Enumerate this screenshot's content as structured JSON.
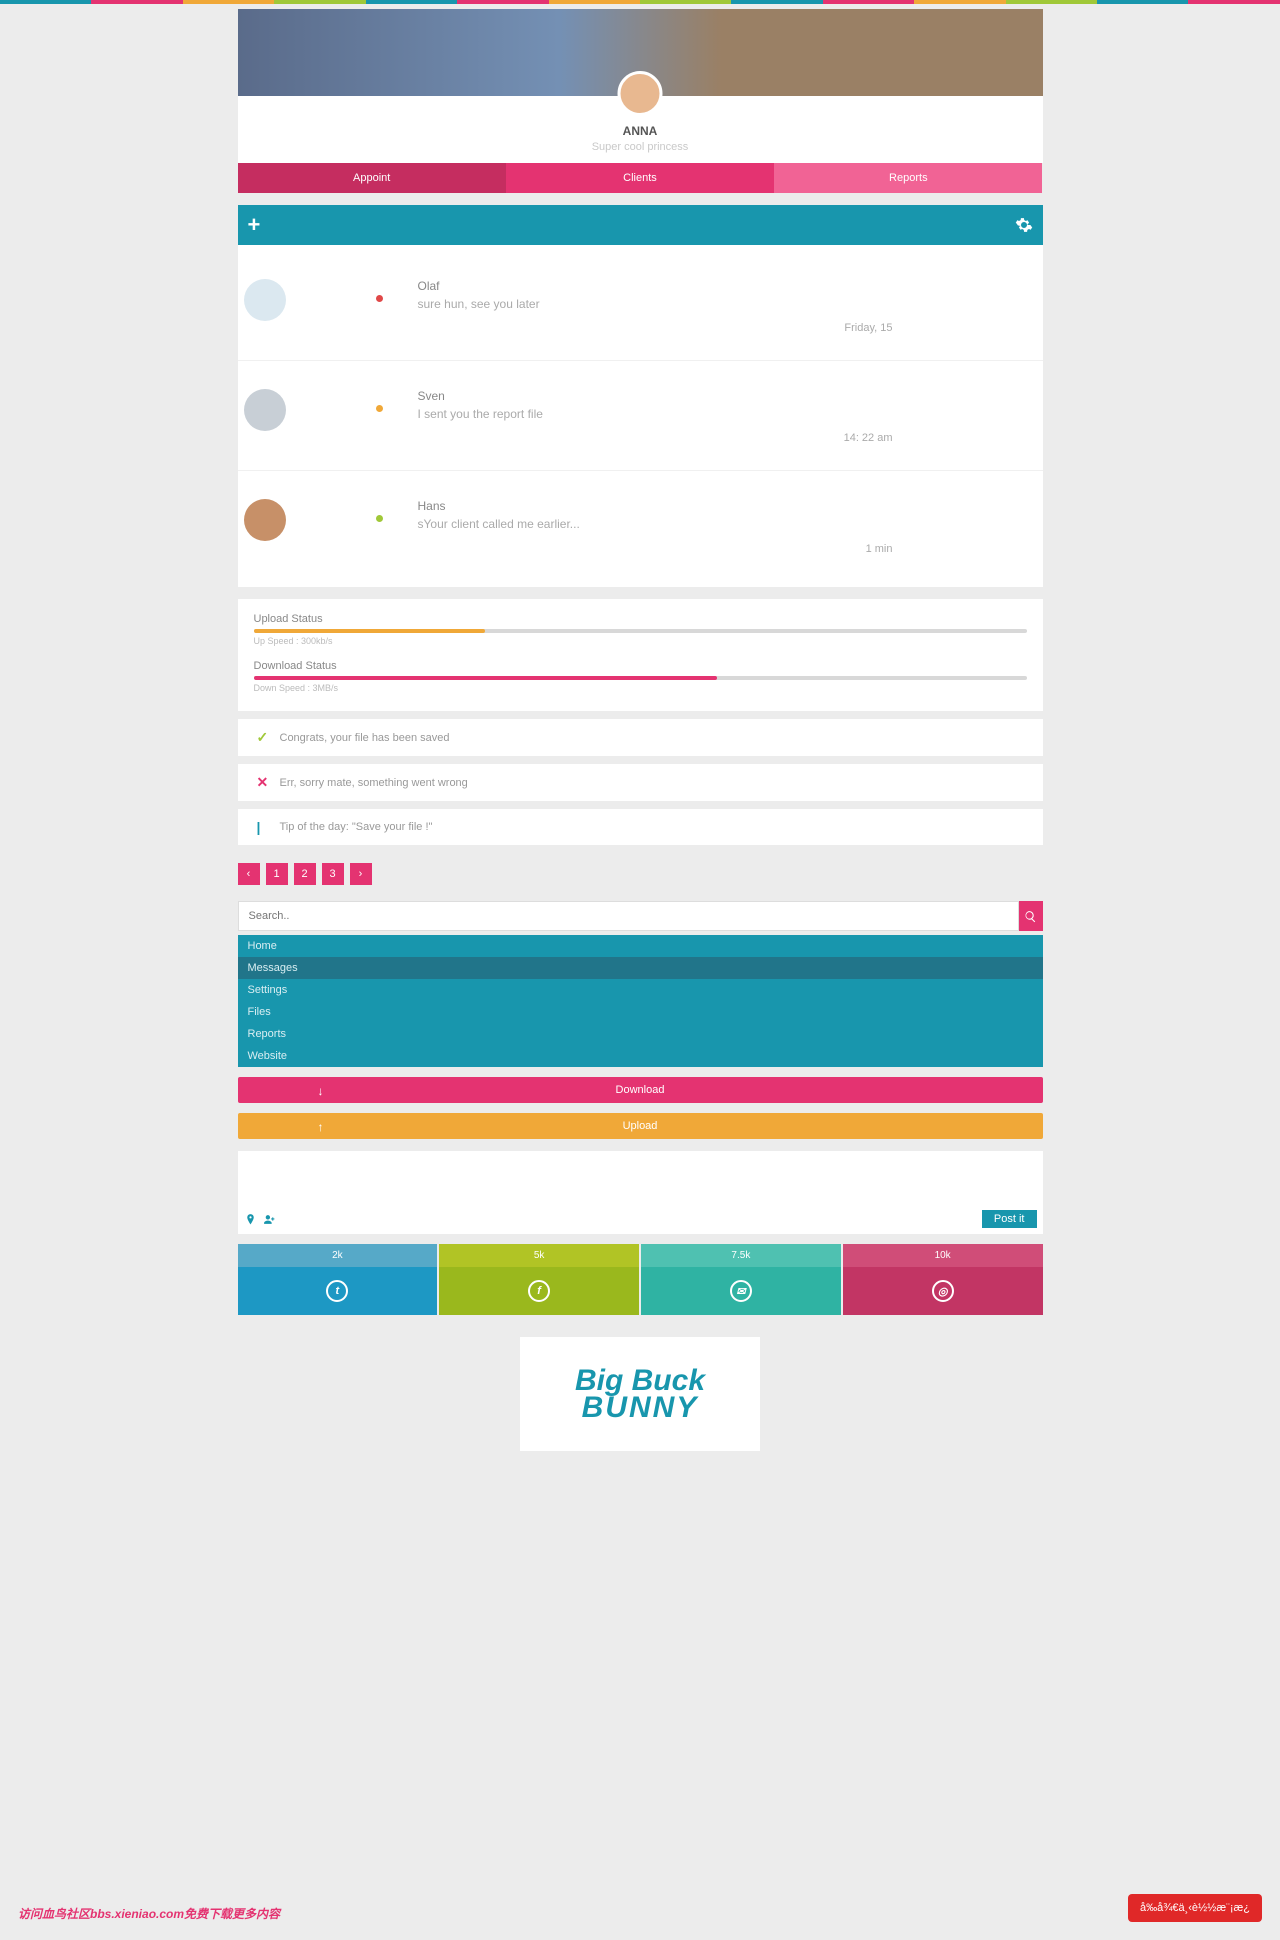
{
  "rainbow": [
    "#1896ad",
    "#e43371",
    "#f0a838",
    "#a0c838",
    "#1896ad",
    "#e43371",
    "#f0a838",
    "#a0c838",
    "#1896ad",
    "#e43371",
    "#f0a838",
    "#a0c838",
    "#1896ad",
    "#e43371"
  ],
  "profile": {
    "name": "ANNA",
    "sub": "Super cool princess"
  },
  "tabs": [
    "Appoint",
    "Clients",
    "Reports"
  ],
  "messages": [
    {
      "name": "Olaf",
      "text": "sure hun, see you later",
      "time": "Friday, 15",
      "dot": "dot-red",
      "avatar": "#dbe8f0"
    },
    {
      "name": "Sven",
      "text": "I sent you the report file",
      "time": "14: 22 am",
      "dot": "dot-orange",
      "avatar": "#c8cfd6"
    },
    {
      "name": "Hans",
      "text": "sYour client called me earlier...",
      "time": "1 min",
      "dot": "dot-green",
      "avatar": "#c79068"
    }
  ],
  "upload": {
    "label": "Upload Status",
    "percent": 30,
    "color": "#f0a838",
    "sub": "Up Speed : 300kb/s"
  },
  "download": {
    "label": "Download Status",
    "percent": 60,
    "color": "#e43371",
    "sub": "Down Speed : 3MB/s"
  },
  "alerts": [
    {
      "icon": "✓",
      "color": "#a0c838",
      "text": "Congrats, your file has been saved"
    },
    {
      "icon": "✕",
      "color": "#e43371",
      "text": "Err, sorry mate, something went wrong"
    },
    {
      "icon": "|",
      "color": "#1896ad",
      "text": "Tip of the day: \"Save your file !\""
    }
  ],
  "pagin": [
    "‹",
    "1",
    "2",
    "3",
    "›"
  ],
  "search": {
    "placeholder": "Search.."
  },
  "nav": [
    "Home",
    "Messages",
    "Settings",
    "Files",
    "Reports",
    "Website"
  ],
  "nav_active": 1,
  "longbtns": [
    {
      "label": "Download",
      "arrow": "↓",
      "cls": "btn-pink"
    },
    {
      "label": "Upload",
      "arrow": "↑",
      "cls": "btn-orange"
    }
  ],
  "postit": "Post it",
  "social": [
    {
      "count": "2k",
      "top": "#56a9c8",
      "bot": "#1d98c4",
      "glyph": "t"
    },
    {
      "count": "5k",
      "top": "#b1c425",
      "bot": "#9ab81d",
      "glyph": "f"
    },
    {
      "count": "7.5k",
      "top": "#4fc1b1",
      "bot": "#2fb3a3",
      "glyph": "✉"
    },
    {
      "count": "10k",
      "top": "#d04d78",
      "bot": "#c23564",
      "glyph": "◎"
    }
  ],
  "bunny": {
    "l1": "Big Buck",
    "l2": "BUNNY"
  },
  "redbtn": "å‰å¾€ä¸‹è½½æ¨¡æ¿",
  "water": "访问血鸟社区bbs.xieniao.com免费下载更多内容"
}
